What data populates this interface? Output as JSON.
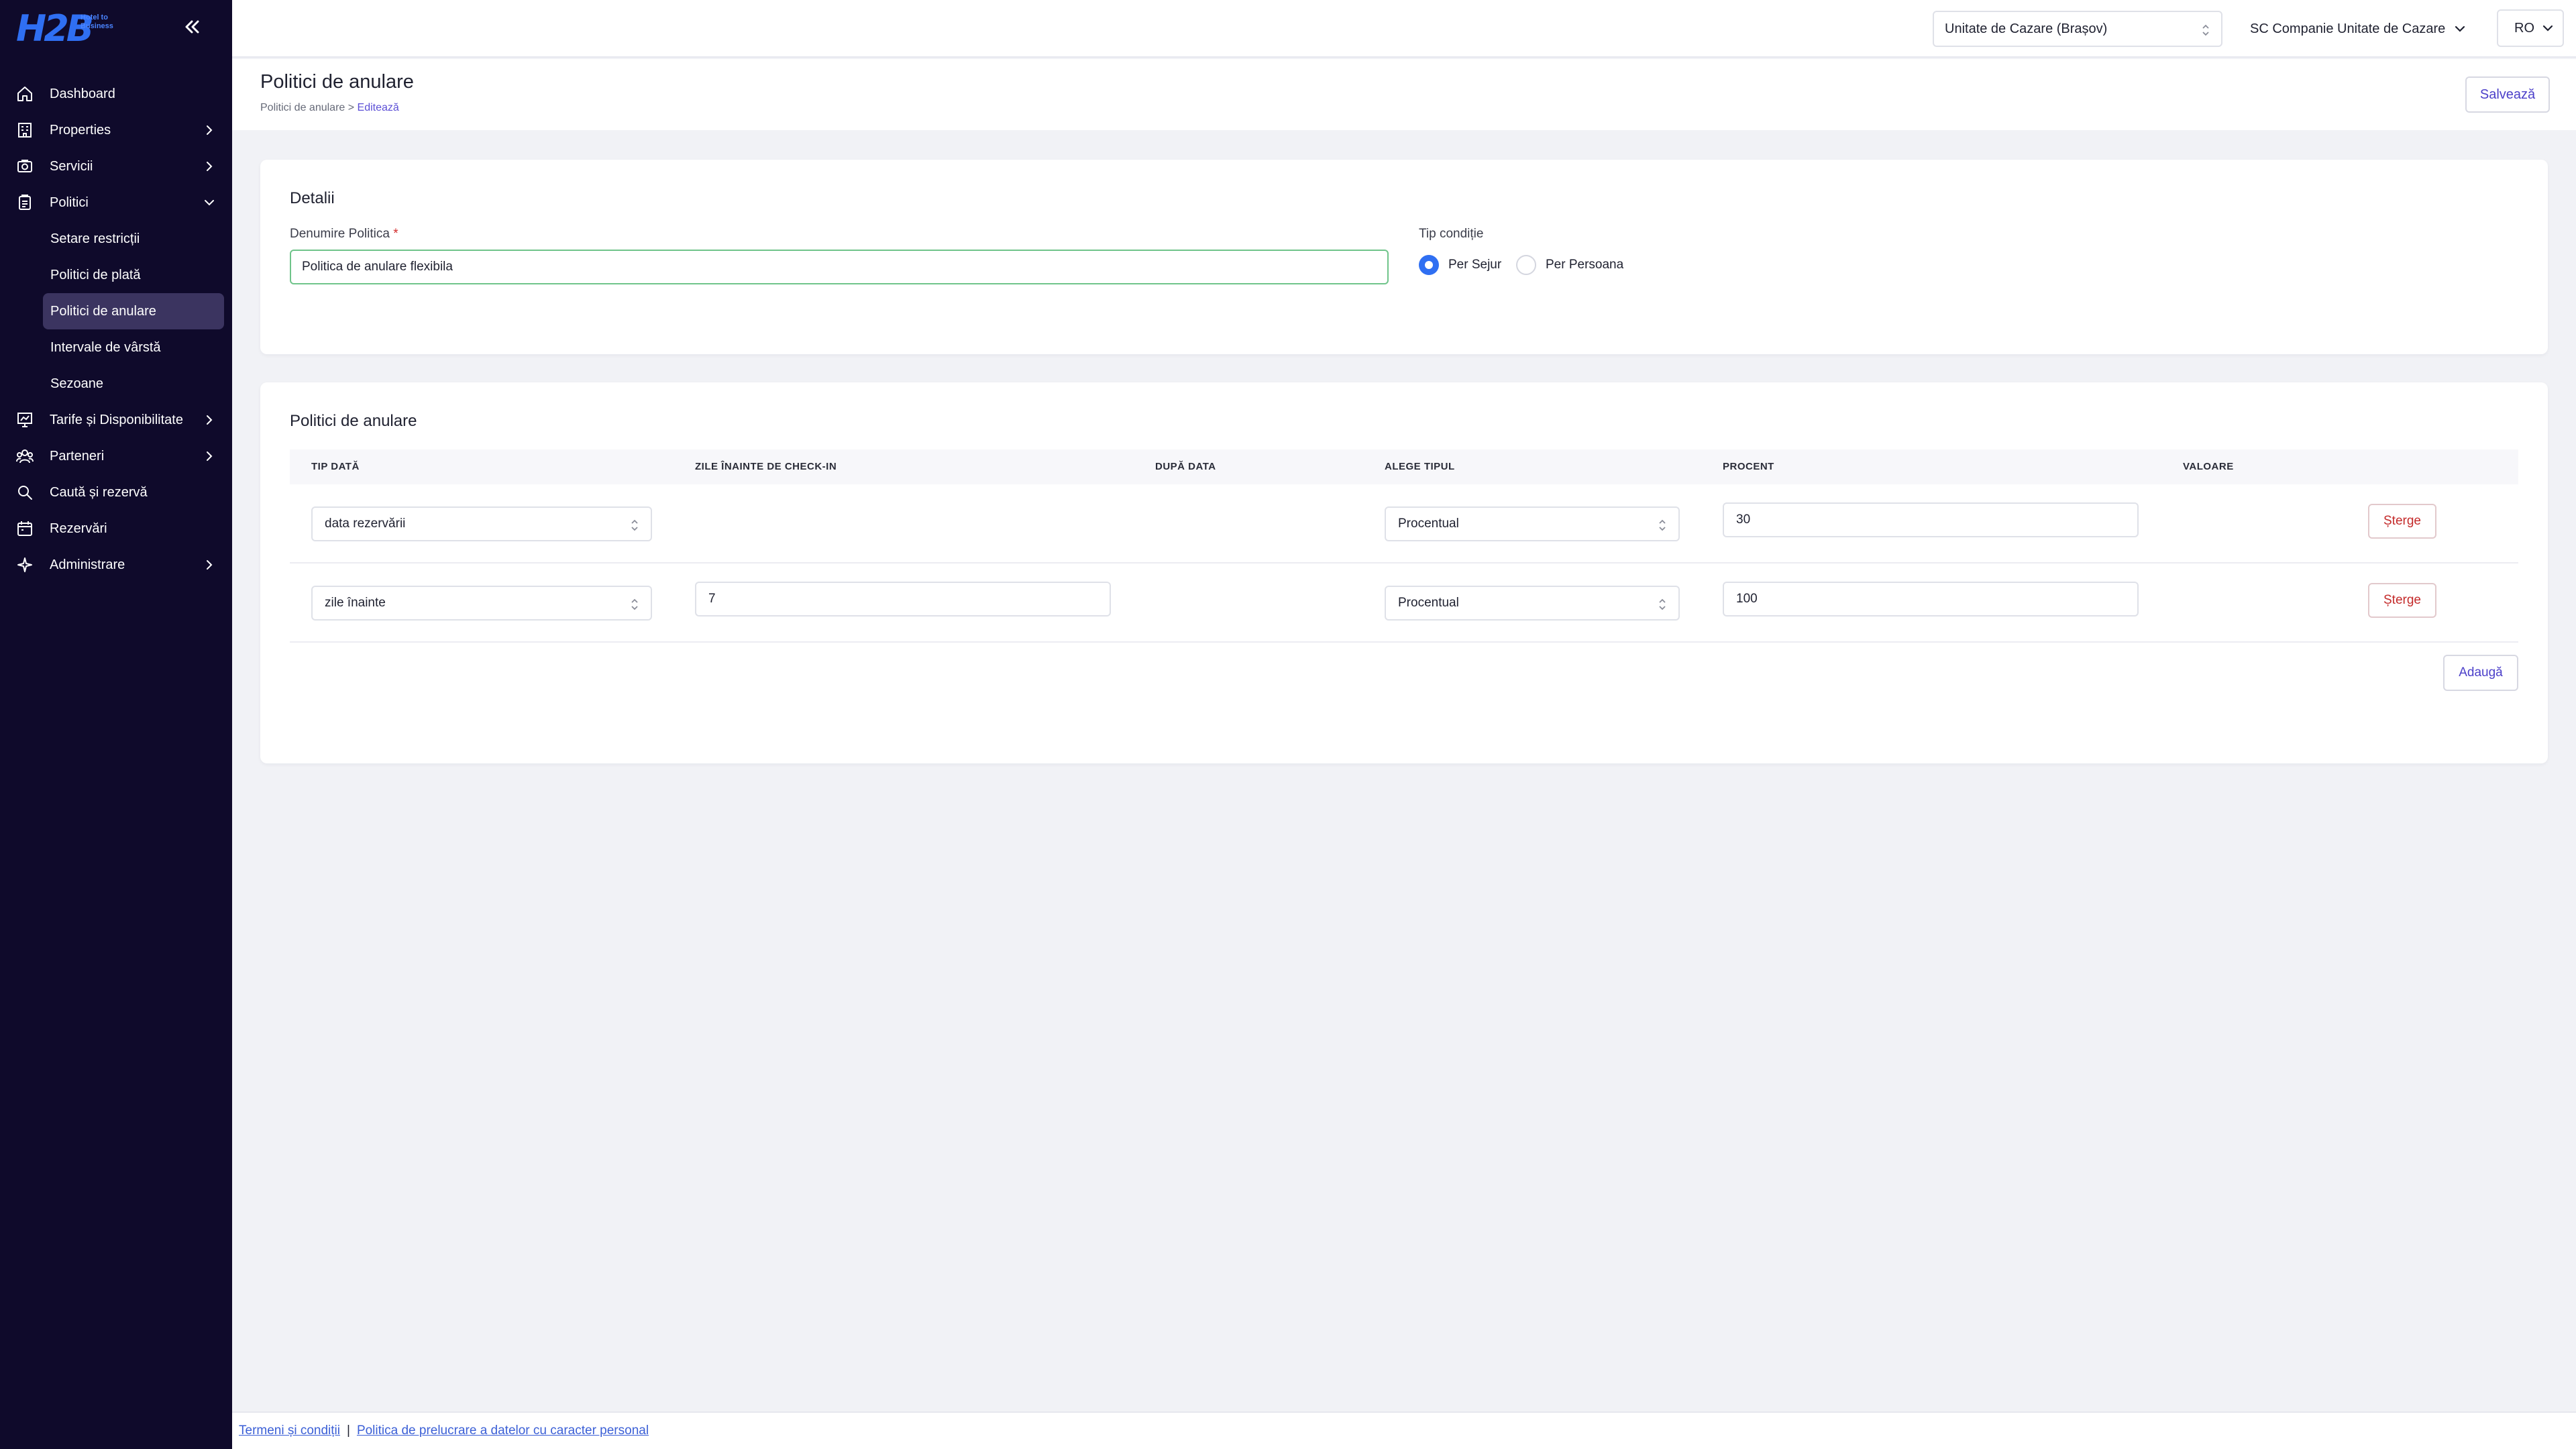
{
  "brand": {
    "logo_text": "H2B",
    "logo_sub": "Hotel to Business"
  },
  "sidebar": {
    "items": [
      {
        "label": "Dashboard"
      },
      {
        "label": "Properties"
      },
      {
        "label": "Servicii"
      },
      {
        "label": "Politici"
      },
      {
        "label": "Tarife și Disponibilitate"
      },
      {
        "label": "Parteneri"
      },
      {
        "label": "Caută și rezervă"
      },
      {
        "label": "Rezervări"
      },
      {
        "label": "Administrare"
      }
    ],
    "politici_sub": [
      {
        "label": "Setare restricții"
      },
      {
        "label": "Politici de plată"
      },
      {
        "label": "Politici de anulare"
      },
      {
        "label": "Intervale de vârstă"
      },
      {
        "label": "Sezoane"
      }
    ]
  },
  "topbar": {
    "unit": "Unitate de Cazare (Brașov)",
    "company": "SC Companie Unitate de Cazare",
    "lang": "RO"
  },
  "header": {
    "title": "Politici de anulare",
    "breadcrumb_parent": "Politici de anulare",
    "breadcrumb_sep": ">",
    "breadcrumb_current": "Editează",
    "save_label": "Salvează"
  },
  "details": {
    "title": "Detalii",
    "name_label": "Denumire Politica",
    "required_mark": "*",
    "name_value": "Politica de anulare flexibila",
    "cond_label": "Tip condiție",
    "cond_options": [
      "Per Sejur",
      "Per Persoana"
    ],
    "cond_selected": "Per Sejur"
  },
  "policies": {
    "title": "Politici de anulare",
    "headers": [
      "TIP DATĂ",
      "ZILE ÎNAINTE DE CHECK-IN",
      "DUPĂ DATA",
      "ALEGE TIPUL",
      "PROCENT",
      "VALOARE"
    ],
    "rows": [
      {
        "tip_data": "data rezervării",
        "zile": "",
        "tip": "Procentual",
        "procent": "30",
        "delete_label": "Șterge"
      },
      {
        "tip_data": "zile înainte",
        "zile": "7",
        "tip": "Procentual",
        "procent": "100",
        "delete_label": "Șterge"
      }
    ],
    "add_label": "Adaugă"
  },
  "footer": {
    "terms": "Termeni și condiții",
    "separator": "|",
    "privacy": "Politica de prelucrare a datelor cu caracter personal"
  },
  "colors": {
    "sidebar_bg": "#0f0a2b",
    "accent": "#2f6ff2",
    "action_text": "#4b3fc9",
    "danger": "#c42a2a"
  }
}
